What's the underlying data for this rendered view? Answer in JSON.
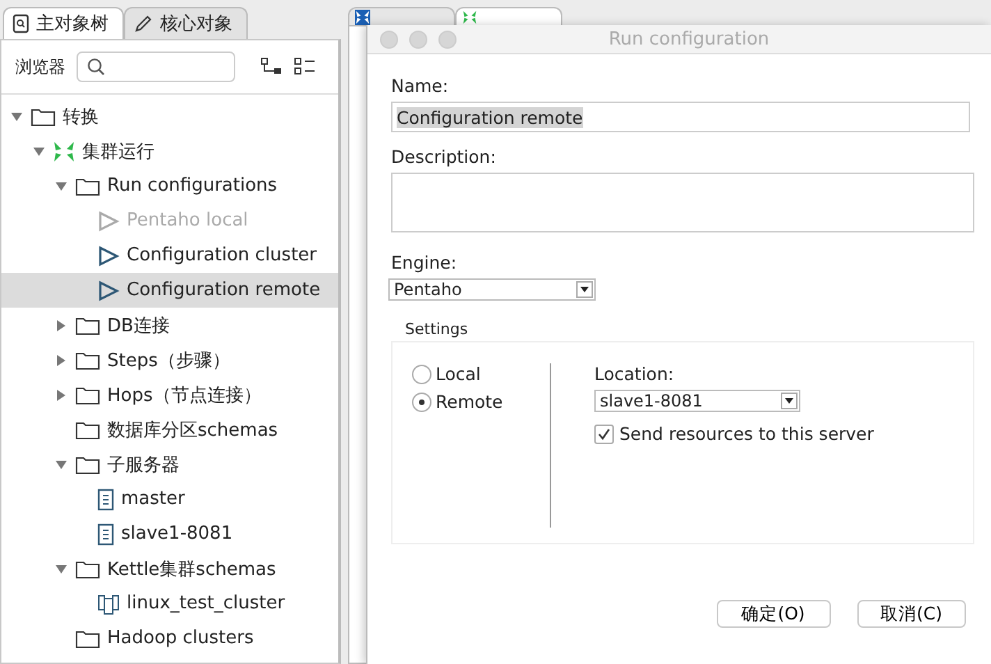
{
  "left_panel": {
    "tabs": [
      {
        "label": "主对象树",
        "selected": true
      },
      {
        "label": "核心对象",
        "selected": false
      }
    ],
    "browser_label": "浏览器",
    "tree": [
      {
        "label": "转换",
        "kind": "folder",
        "expanded": true,
        "children": [
          {
            "label": "集群运行",
            "kind": "cluster",
            "expanded": true,
            "children": [
              {
                "label": "Run configurations",
                "kind": "folder",
                "expanded": true,
                "children": [
                  {
                    "label": "Pentaho local",
                    "kind": "run",
                    "disabled": true,
                    "selected": false
                  },
                  {
                    "label": "Configuration cluster",
                    "kind": "run",
                    "disabled": false,
                    "selected": false
                  },
                  {
                    "label": "Configuration remote",
                    "kind": "run",
                    "disabled": false,
                    "selected": true
                  }
                ]
              },
              {
                "label": "DB连接",
                "kind": "folder",
                "expanded": false
              },
              {
                "label": "Steps（步骤）",
                "kind": "folder",
                "expanded": false
              },
              {
                "label": "Hops（节点连接）",
                "kind": "folder",
                "expanded": false
              },
              {
                "label": "数据库分区schemas",
                "kind": "folder"
              },
              {
                "label": "子服务器",
                "kind": "folder",
                "expanded": true,
                "children": [
                  {
                    "label": "master",
                    "kind": "server"
                  },
                  {
                    "label": "slave1-8081",
                    "kind": "server"
                  }
                ]
              },
              {
                "label": "Kettle集群schemas",
                "kind": "folder",
                "expanded": true,
                "children": [
                  {
                    "label": "linux_test_cluster",
                    "kind": "schema"
                  }
                ]
              },
              {
                "label": "Hadoop clusters",
                "kind": "folder"
              }
            ]
          }
        ]
      }
    ]
  },
  "dialog": {
    "title": "Run configuration",
    "name_label": "Name:",
    "name_value": "Configuration remote",
    "description_label": "Description:",
    "engine_label": "Engine:",
    "engine_value": "Pentaho",
    "settings_label": "Settings",
    "modes": [
      {
        "label": "Local",
        "selected": false
      },
      {
        "label": "Remote",
        "selected": true
      }
    ],
    "location_label": "Location:",
    "location_value": "slave1-8081",
    "send_resources": {
      "label": "Send resources to this server",
      "checked": true
    },
    "buttons": [
      "确定(O)",
      "取消(C)"
    ]
  }
}
